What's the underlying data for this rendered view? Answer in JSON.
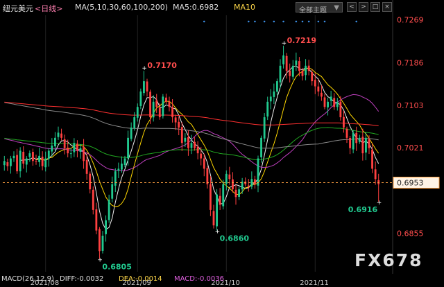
{
  "header": {
    "symbol": "纽元美元",
    "period": "<日线>",
    "ma_label": "MA(5,10,30,60,100,200)",
    "ma5": "MA5:0.6982",
    "ma10": "MA10",
    "select_label": "全部主题",
    "window_buttons": [
      "<",
      ">",
      "□",
      "×"
    ]
  },
  "watermark": "FX678",
  "macd": {
    "label": "MACD(26,12,9)",
    "diff": "DIFF:-0.0032",
    "dea": "DEA:-0.0014",
    "macd": "MACD:-0.0036"
  },
  "colors": {
    "up": "#21c98f",
    "down": "#ff4040",
    "ma5": "#f0f0f0",
    "ma10": "#ffd700",
    "ma30": "#c040c0",
    "ma60": "#22aa22",
    "ma100": "#8a8a8a",
    "ma200": "#ff3030",
    "current_price": "#ffa040",
    "high_label": "#ff4d4d",
    "low_label": "#21c98f",
    "axis_label": "#ff4d4d"
  },
  "chart_data": {
    "type": "candlestick",
    "symbol": "NZD/USD",
    "y_ticks": [
      "0.7269",
      "0.7186",
      "0.7103",
      "0.7021",
      "0.6953",
      "0.6855"
    ],
    "y_tick_values": [
      0.7269,
      0.7186,
      0.7103,
      0.7021,
      0.6855
    ],
    "ylim": [
      0.678,
      0.7278
    ],
    "current_price": 0.6953,
    "current_price_label": "0.6953",
    "x_labels": [
      "2021/08",
      "2021/09",
      "2021/10",
      "2021/11"
    ],
    "x_label_index": [
      13,
      42,
      70,
      98
    ],
    "annotations": [
      {
        "text": "0.7170",
        "value": 0.717,
        "index": 44,
        "kind": "high"
      },
      {
        "text": "0.7219",
        "value": 0.7219,
        "index": 88,
        "kind": "high"
      },
      {
        "text": "0.6805",
        "value": 0.6805,
        "index": 30,
        "kind": "low"
      },
      {
        "text": "0.6860",
        "value": 0.686,
        "index": 67,
        "kind": "low"
      },
      {
        "text": "0.6916",
        "value": 0.6916,
        "index": 118,
        "kind": "low"
      }
    ],
    "close": [
      0.6995,
      0.6985,
      0.7,
      0.7005,
      0.6975,
      0.7015,
      0.699,
      0.7,
      0.701,
      0.6995,
      0.6995,
      0.7005,
      0.6985,
      0.7,
      0.7015,
      0.7025,
      0.704,
      0.705,
      0.704,
      0.702,
      0.701,
      0.701,
      0.703,
      0.7015,
      0.702,
      0.6995,
      0.697,
      0.694,
      0.69,
      0.686,
      0.682,
      0.685,
      0.688,
      0.692,
      0.695,
      0.6975,
      0.698,
      0.699,
      0.7,
      0.704,
      0.706,
      0.708,
      0.71,
      0.713,
      0.715,
      0.713,
      0.708,
      0.711,
      0.71,
      0.708,
      0.712,
      0.711,
      0.71,
      0.708,
      0.707,
      0.706,
      0.703,
      0.704,
      0.702,
      0.703,
      0.702,
      0.701,
      0.7,
      0.698,
      0.695,
      0.69,
      0.687,
      0.693,
      0.691,
      0.695,
      0.697,
      0.696,
      0.694,
      0.6925,
      0.694,
      0.6955,
      0.695,
      0.6945,
      0.696,
      0.695,
      0.7,
      0.704,
      0.708,
      0.711,
      0.712,
      0.713,
      0.715,
      0.718,
      0.72,
      0.717,
      0.716,
      0.718,
      0.719,
      0.717,
      0.716,
      0.718,
      0.717,
      0.715,
      0.714,
      0.713,
      0.712,
      0.71,
      0.711,
      0.712,
      0.71,
      0.711,
      0.708,
      0.706,
      0.704,
      0.702,
      0.705,
      0.703,
      0.704,
      0.701,
      0.704,
      0.702,
      0.698,
      0.696,
      0.695
    ],
    "ma_periods": [
      5,
      10,
      30,
      60,
      100,
      200
    ],
    "ma5_last": 0.6982
  }
}
